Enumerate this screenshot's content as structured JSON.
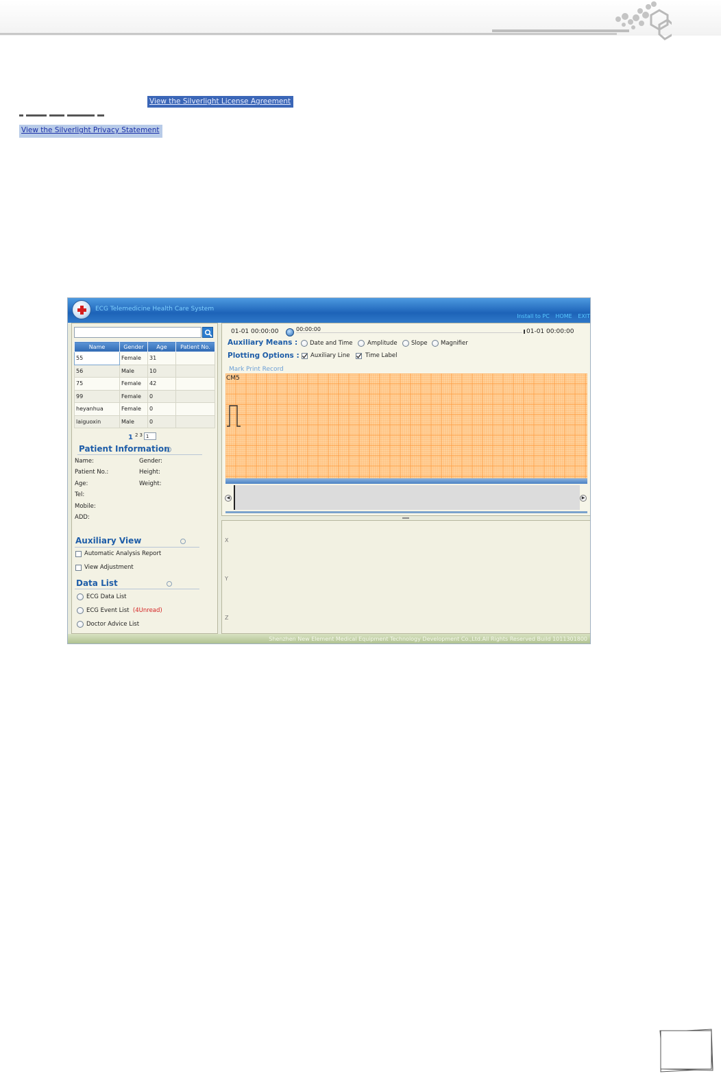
{
  "links": {
    "license": "View the Silverlight License Agreement",
    "privacy": "View the Silverlight Privacy Statement"
  },
  "app": {
    "title": "ECG Telemedicine Health Care System",
    "nav": [
      "Install to PC",
      "HOME",
      "EXIT"
    ],
    "footer": "Shenzhen New Element Medical Equipment Technology Development Co.,Ltd.All Rights Reserved Build 1011301800",
    "patient_table": {
      "headers": [
        "Name",
        "Gender",
        "Age",
        "Patient No."
      ],
      "rows": [
        [
          "55",
          "Female",
          "31",
          ""
        ],
        [
          "56",
          "Male",
          "10",
          ""
        ],
        [
          "75",
          "Female",
          "42",
          ""
        ],
        [
          "99",
          "Female",
          "0",
          ""
        ],
        [
          "heyanhua",
          "Female",
          "0",
          ""
        ],
        [
          "laiguoxin",
          "Male",
          "0",
          ""
        ]
      ]
    },
    "pager": {
      "current": "1",
      "others": [
        "2",
        "3"
      ],
      "input": "1"
    },
    "patient_info": {
      "title": "Patient Information",
      "fields": {
        "name": "Name:",
        "gender": "Gender:",
        "patient_no": "Patient No.:",
        "height": "Height:",
        "age": "Age:",
        "weight": "Weight:",
        "tel": "Tel:",
        "mobile": "Mobile:",
        "add": "ADD:"
      }
    },
    "auxiliary_view": {
      "title": "Auxiliary View",
      "options": [
        "Automatic Analysis Report",
        "View Adjustment"
      ]
    },
    "data_list": {
      "title": "Data List",
      "options": [
        "ECG Data List",
        "ECG Event List",
        "Doctor Advice List"
      ],
      "unread": "(4Unread)"
    },
    "timeline": {
      "start": "01-01 00:00:00",
      "current": "00:00:00",
      "end": "01-01 00:00:00"
    },
    "auxiliary_means": {
      "label": "Auxiliary Means :",
      "options": [
        "Date and Time",
        "Amplitude",
        "Slope",
        "Magnifier"
      ]
    },
    "plotting_options": {
      "label": "Plotting Options :",
      "options": [
        "Auxiliary Line",
        "Time Label"
      ],
      "checked": [
        true,
        true
      ]
    },
    "mark_print": "Mark Print Record",
    "ecg": {
      "lead": "CM5",
      "grid_color": "#ff9a3c",
      "paper_color": "#ffd9a8"
    },
    "axes": [
      "X",
      "Y",
      "Z"
    ],
    "colors": {
      "accent": "#1e5da8",
      "titlebar": "#2f78c8",
      "unread": "#d42020"
    }
  }
}
